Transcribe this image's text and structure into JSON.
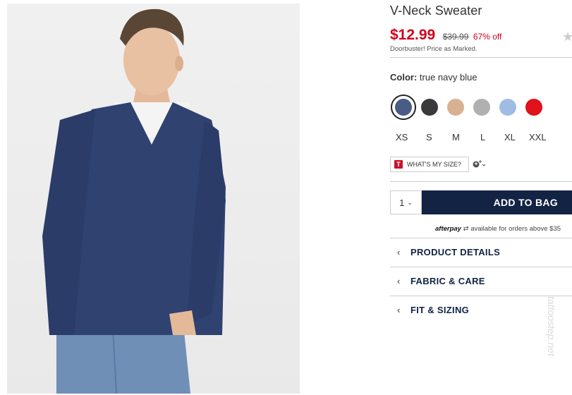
{
  "product": {
    "title": "V-Neck Sweater",
    "sale_price": "$12.99",
    "original_price": "$39.99",
    "discount": "67% off",
    "note": "Doorbuster! Price as Marked.",
    "rating_icon": "star-icon"
  },
  "color": {
    "label": "Color:",
    "selected_name": "true navy blue",
    "swatches": [
      "#4a5b86",
      "#3a3a3a",
      "#d9b191",
      "#b0b0b0",
      "#9fbde2",
      "#e0121c"
    ]
  },
  "sizes": [
    "XS",
    "S",
    "M",
    "L",
    "XL",
    "XXL"
  ],
  "size_tool": {
    "badge": "T",
    "label": "WHAT'S MY SIZE?",
    "fit_icon": "person-fit-icon"
  },
  "cart": {
    "quantity": "1",
    "add_label": "ADD TO BAG"
  },
  "afterpay": {
    "brand": "afterpay",
    "text": "available for orders above $35"
  },
  "accordion": [
    {
      "label": "PRODUCT DETAILS"
    },
    {
      "label": "FABRIC & CARE"
    },
    {
      "label": "FIT & SIZING"
    }
  ],
  "watermark": "tattoostep.net"
}
